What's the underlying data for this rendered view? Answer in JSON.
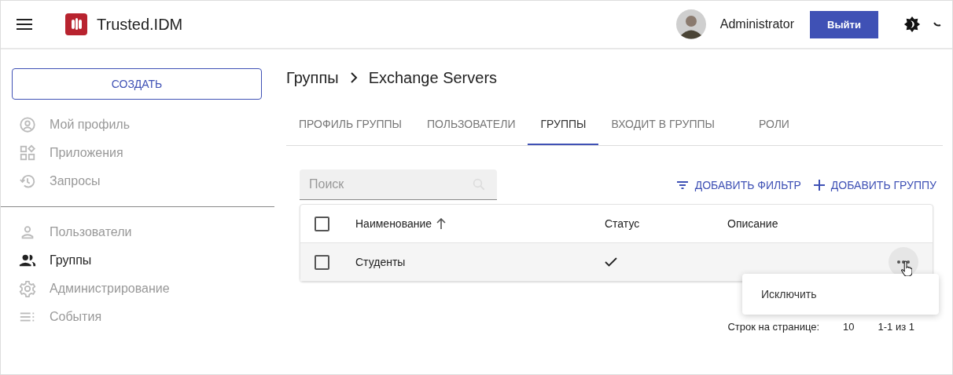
{
  "app": {
    "title": "Trusted.IDM"
  },
  "user": {
    "name": "Administrator",
    "logout": "Выйти"
  },
  "sidebar": {
    "create_button": "СОЗДАТЬ",
    "sections": [
      [
        {
          "label": "Мой профиль",
          "selected": false
        },
        {
          "label": "Приложения",
          "selected": false
        },
        {
          "label": "Запросы",
          "selected": false
        }
      ],
      [
        {
          "label": "Пользователи",
          "selected": false
        },
        {
          "label": "Группы",
          "selected": true
        },
        {
          "label": "Администрирование",
          "selected": false
        },
        {
          "label": "События",
          "selected": false
        }
      ]
    ]
  },
  "breadcrumb": [
    "Группы",
    "Exchange Servers"
  ],
  "tabs": [
    {
      "label": "ПРОФИЛЬ ГРУППЫ",
      "selected": false
    },
    {
      "label": "ПОЛЬЗОВАТЕЛИ",
      "selected": false
    },
    {
      "label": "ГРУППЫ",
      "selected": true
    },
    {
      "label": "ВХОДИТ В ГРУППЫ",
      "selected": false
    },
    {
      "label": "РОЛИ",
      "selected": false
    }
  ],
  "search": {
    "placeholder": "Поиск"
  },
  "actions": [
    "ДОБАВИТЬ ФИЛЬТР",
    "ДОБАВИТЬ ГРУППУ"
  ],
  "table": {
    "header_checked": false,
    "columns": [
      "Наименование",
      "Статус",
      "Описание"
    ],
    "rows": [
      {
        "checked": false,
        "name": "Студенты",
        "status": true
      }
    ]
  },
  "menu": {
    "items": [
      "Исключить"
    ]
  },
  "pagination": {
    "rows_label": "Строк на странице:",
    "rows_per_page": "10",
    "range": "1-1 из 1"
  }
}
